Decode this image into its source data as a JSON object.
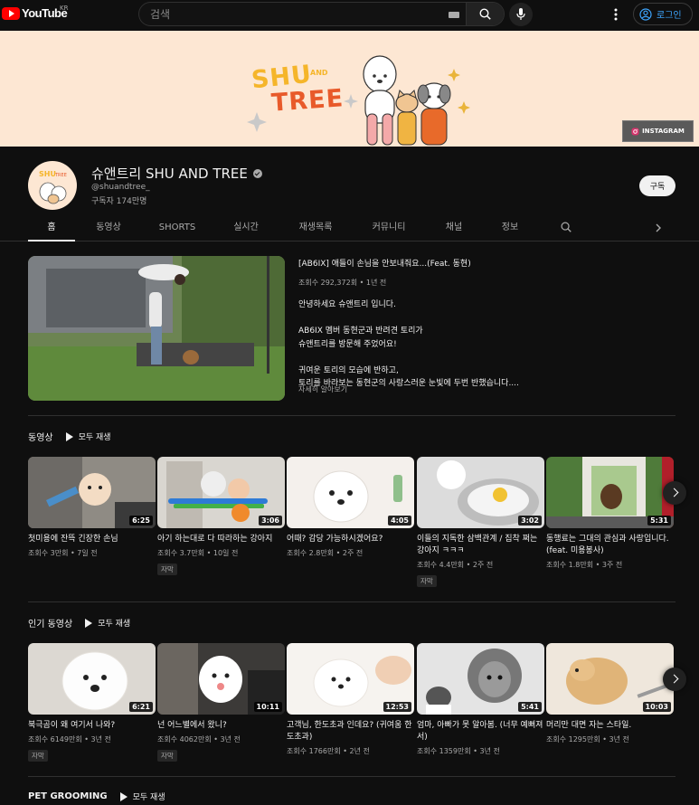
{
  "header": {
    "logo_text": "YouTube",
    "country": "KR",
    "search_placeholder": "검색",
    "login_label": "로그인"
  },
  "banner": {
    "logo_line1": "SHU",
    "logo_and": "AND",
    "logo_line2": "TREE",
    "instagram_label": "INSTAGRAM"
  },
  "channel": {
    "name": "슈앤트리 SHU AND TREE",
    "handle": "@shuandtree_",
    "subscribers": "구독자 174만명",
    "subscribe_label": "구독",
    "avatar_text": "SHU TREE"
  },
  "tabs": [
    {
      "label": "홈",
      "active": true
    },
    {
      "label": "동영상"
    },
    {
      "label": "SHORTS"
    },
    {
      "label": "실시간"
    },
    {
      "label": "재생목록"
    },
    {
      "label": "커뮤니티"
    },
    {
      "label": "채널"
    },
    {
      "label": "정보"
    }
  ],
  "featured": {
    "title": "[AB6IX] 애들이 손님을 안보내줘요...(Feat. 동현)",
    "meta": "조회수 292,372회 • 1년 전",
    "description": [
      "안녕하세요 슈앤트리 입니다.",
      "",
      "AB6IX 멤버 동현군과 반려견 토리가",
      "슈앤트리를 방문해 주었어요!",
      "",
      "귀여운 토리의 모습에 반하고,",
      "토리를 바라보는 동현군의 사랑스러운 눈빛에 두번 반했습니다...."
    ],
    "more_label": "자세히 알아보기"
  },
  "shelves": [
    {
      "title": "동영상",
      "play_all": "모두 재생",
      "videos": [
        {
          "title": "첫미용에 잔뜩 긴장한 손님",
          "meta": "조회수 3만회 • 7일 전",
          "duration": "6:25",
          "cc": ""
        },
        {
          "title": "아기 하는대로 다 따라하는 강아지",
          "meta": "조회수 3.7만회 • 10일 전",
          "duration": "3:06",
          "cc": "자막"
        },
        {
          "title": "어때? 감당 가능하시겠어요?",
          "meta": "조회수 2.8만회 • 2주 전",
          "duration": "4:05",
          "cc": ""
        },
        {
          "title": "이들의 지독한 삼백관계 / 집착 쩌는 강아지 ㅋㅋㅋ",
          "meta": "조회수 4.4만회 • 2주 전",
          "duration": "3:02",
          "cc": "자막"
        },
        {
          "title": "동행료는 그대의 관심과 사랑입니다. (feat. 미용봉사)",
          "meta": "조회수 1.8만회 • 3주 전",
          "duration": "5:31",
          "cc": ""
        }
      ]
    },
    {
      "title": "인기 동영상",
      "play_all": "모두 재생",
      "videos": [
        {
          "title": "북극곰이 왜 여기서 나와?",
          "meta": "조회수 6149만회 • 3년 전",
          "duration": "6:21",
          "cc": "자막"
        },
        {
          "title": "넌 어느별에서 왔니?",
          "meta": "조회수 4062만회 • 3년 전",
          "duration": "10:11",
          "cc": "자막"
        },
        {
          "title": "고객님, 한도초과 인데요? (귀여움 한도초과)",
          "meta": "조회수 1766만회 • 2년 전",
          "duration": "12:53",
          "cc": ""
        },
        {
          "title": "엄마, 아빠가 못 알아봄. (너무 예뻐져서)",
          "meta": "조회수 1359만회 • 3년 전",
          "duration": "5:41",
          "cc": ""
        },
        {
          "title": "머리만 대면 자는 스타일.",
          "meta": "조회수 1295만회 • 3년 전",
          "duration": "10:03",
          "cc": ""
        }
      ]
    },
    {
      "title": "PET GROOMING",
      "play_all": "모두 재생"
    }
  ],
  "colors": {
    "background": "#0f0f0f",
    "accent_red": "#ff0000",
    "link_blue": "#3ea6ff",
    "banner_bg": "#fde7d3"
  }
}
